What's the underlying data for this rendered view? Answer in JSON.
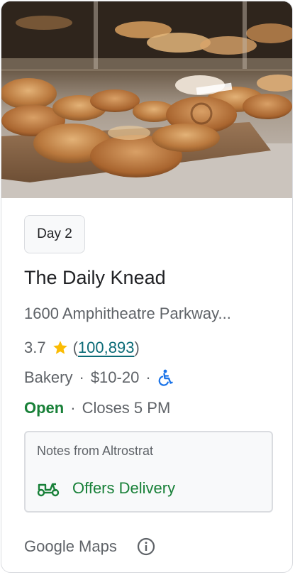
{
  "chip": {
    "label": "Day 2"
  },
  "place": {
    "name": "The Daily Knead",
    "address": "1600 Amphitheatre Parkway...",
    "rating": "3.7",
    "reviews_open": "(",
    "reviews": "100,893",
    "reviews_close": ")",
    "category": "Bakery",
    "price": "$10-20",
    "status": "Open",
    "hours": "Closes 5 PM"
  },
  "notes": {
    "title": "Notes from Altrostrat",
    "delivery": "Offers Delivery"
  },
  "footer": {
    "source": "Google Maps"
  },
  "separator": "·",
  "colors": {
    "open": "#188038",
    "star": "#fbbc04",
    "link": "#0b6b77",
    "accessible_icon": "#1a73e8"
  },
  "icons": {
    "star": "star-icon",
    "wheelchair": "wheelchair-icon",
    "delivery": "scooter-icon",
    "info": "info-icon"
  }
}
